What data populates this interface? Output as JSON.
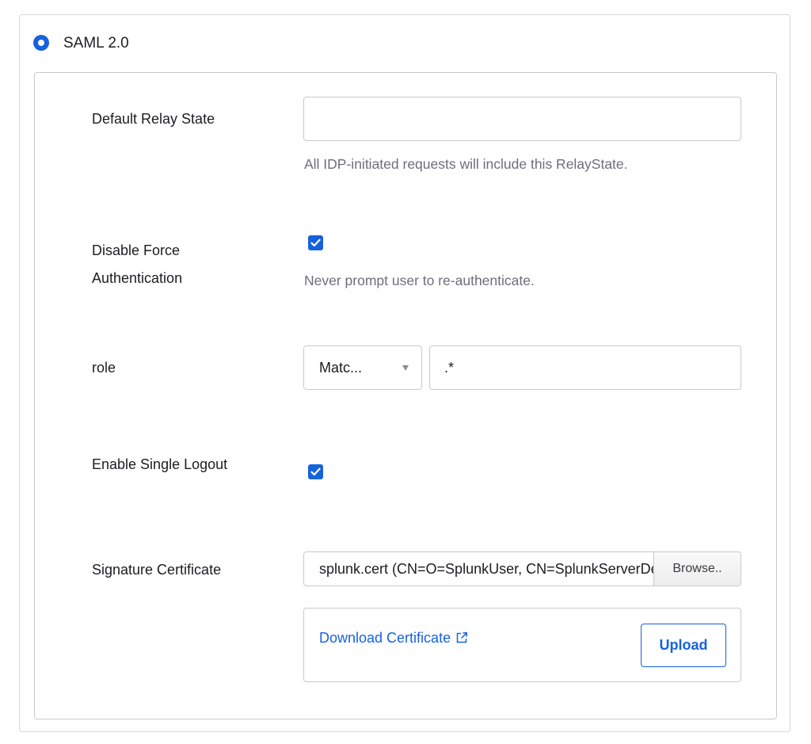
{
  "saml": {
    "radio_label": "SAML 2.0"
  },
  "relay_state": {
    "label": "Default Relay State",
    "value": "",
    "hint": "All IDP-initiated requests will include this RelayState."
  },
  "force_auth": {
    "label_line1": "Disable Force",
    "label_line2": "Authentication",
    "checked": true,
    "hint": "Never prompt user to re-authenticate."
  },
  "role": {
    "label": "role",
    "match_selected": "Matc...",
    "pattern_value": ".*"
  },
  "single_logout": {
    "label": "Enable Single Logout",
    "checked": true
  },
  "signature_certificate": {
    "label": "Signature Certificate",
    "file_name": "splunk.cert (CN=O=SplunkUser, CN=SplunkServerDefaultCert)",
    "browse_label": "Browse..",
    "download_label": "Download Certificate",
    "upload_label": "Upload"
  },
  "colors": {
    "accent": "#1662dd",
    "border": "#c9c9ce",
    "hint_text": "#6e6e78"
  }
}
